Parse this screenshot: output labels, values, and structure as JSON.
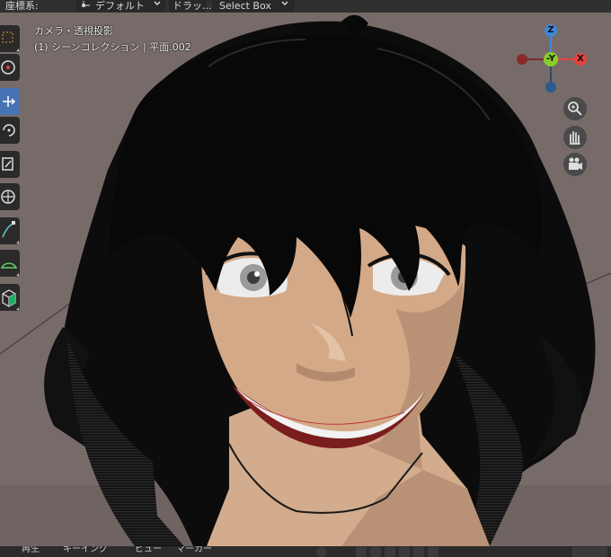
{
  "header": {
    "coordinate_label": "座標系:",
    "orientation_value": "デフォルト",
    "drag_label": "ドラッ...",
    "select_mode": "Select Box"
  },
  "viewport": {
    "view_name": "カメラ・透視投影",
    "collection_info": "(1) シーンコレクション | 平面.002"
  },
  "gizmo": {
    "z_label": "Z",
    "neg_y_label": "-Y",
    "x_label": "X",
    "colors": {
      "x": "#e8423f",
      "y": "#8ccd2a",
      "z": "#3f88d9"
    }
  },
  "toolbar": {
    "tools": [
      {
        "name": "select-box-icon",
        "active": false
      },
      {
        "name": "cursor-icon",
        "active": false
      },
      {
        "name": "move-icon",
        "active": true
      },
      {
        "name": "rotate-icon",
        "active": false
      },
      {
        "name": "scale-icon",
        "active": false
      },
      {
        "name": "transform-icon",
        "active": false
      },
      {
        "name": "annotate-icon",
        "active": false
      },
      {
        "name": "measure-icon",
        "active": false
      },
      {
        "name": "add-cube-icon",
        "active": false
      }
    ]
  },
  "nav_buttons": [
    "zoom-icon",
    "pan-hand-icon",
    "camera-view-icon"
  ],
  "bottombar": {
    "playback_label": "再生",
    "keying_label": "キーイング",
    "view_label": "ビュー",
    "marker_label": "マーカー"
  }
}
